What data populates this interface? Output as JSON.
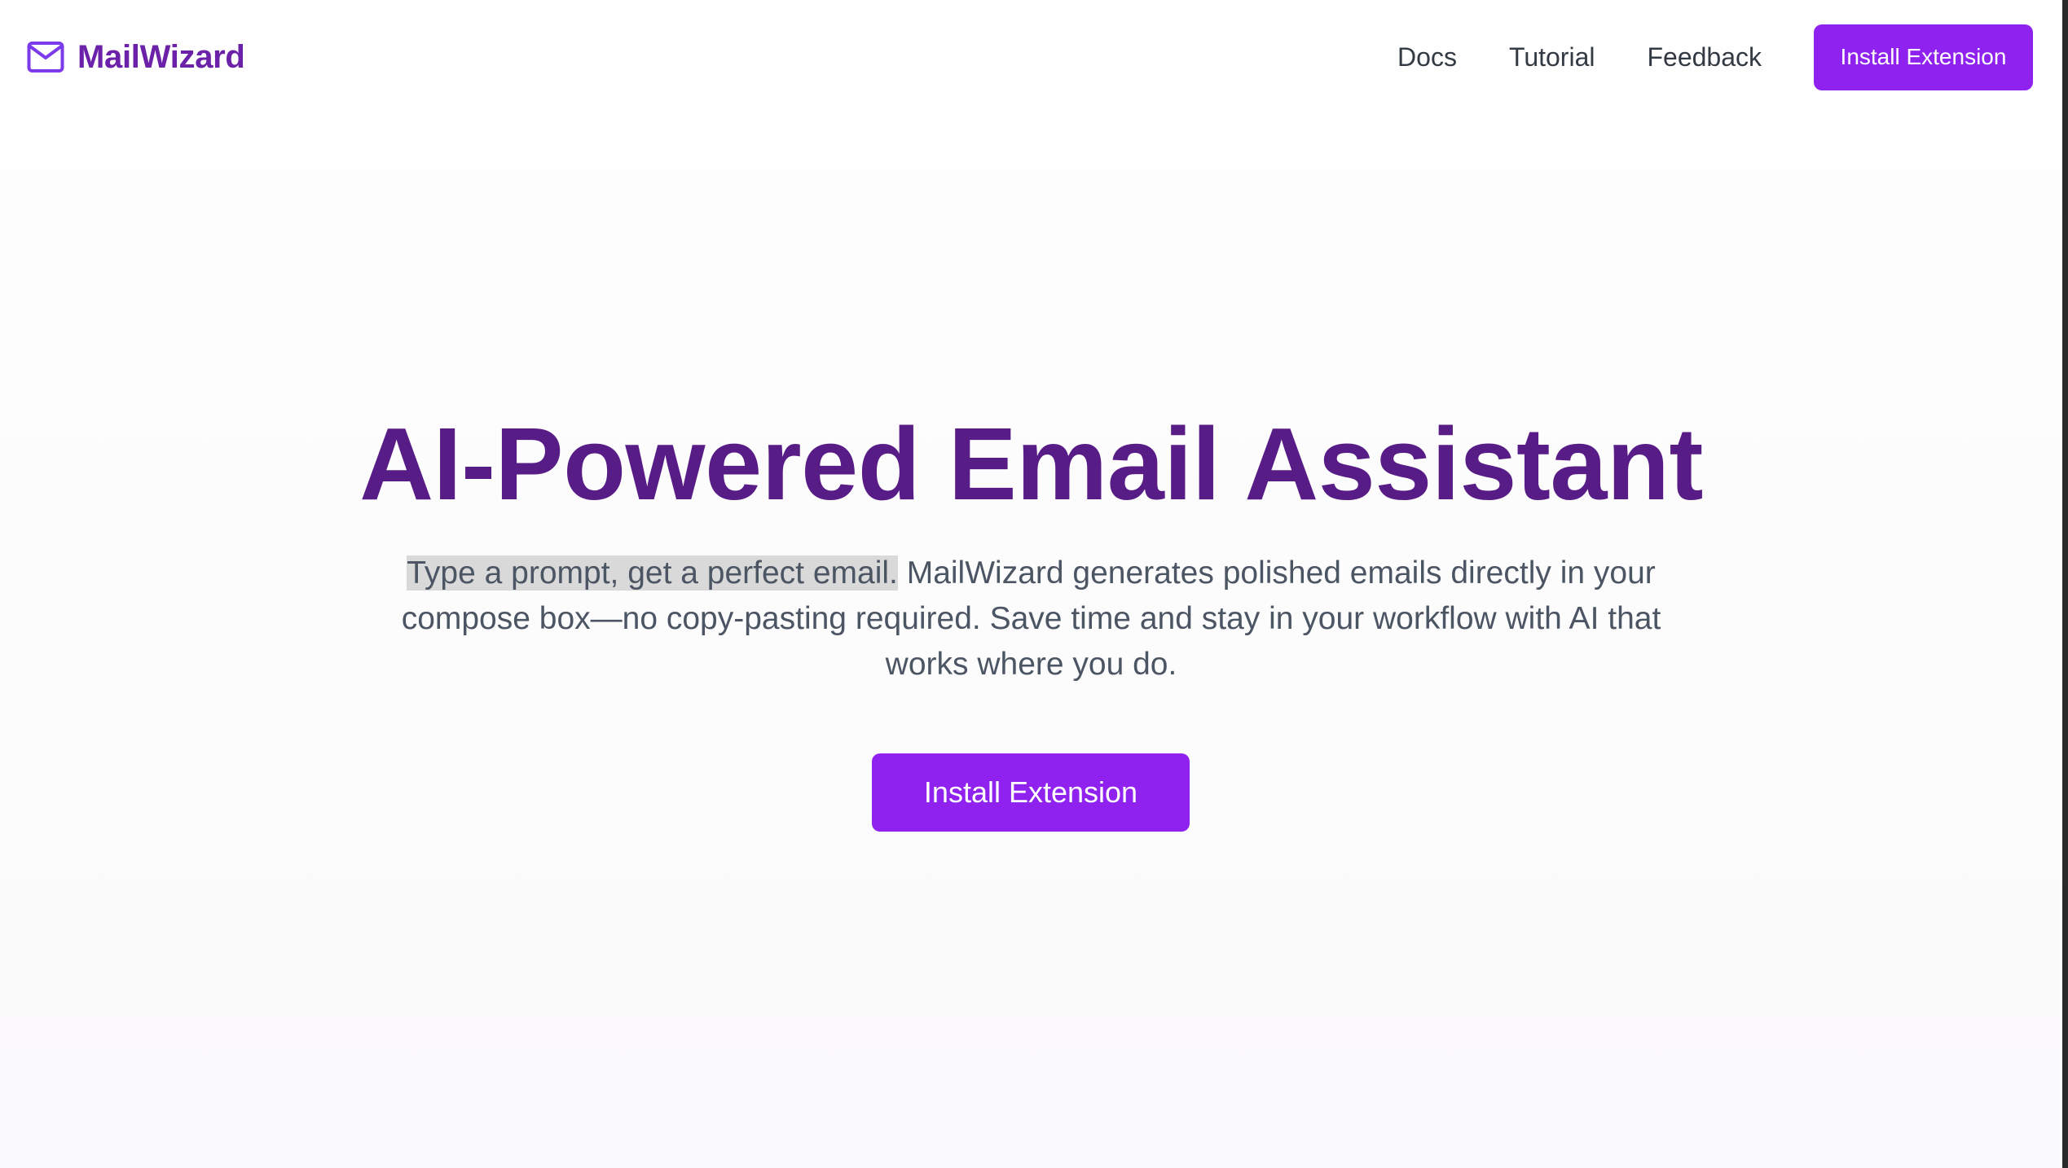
{
  "brand": {
    "name": "MailWizard",
    "icon": "mail-envelope-icon",
    "color": "#6b21a8"
  },
  "nav": {
    "links": [
      "Docs",
      "Tutorial",
      "Feedback"
    ],
    "install_label": "Install Extension"
  },
  "hero": {
    "title": "AI-Powered Email Assistant",
    "desc_highlight": "Type a prompt, get a perfect email.",
    "desc_rest": " MailWizard generates polished emails directly in your compose box—no copy-pasting required. Save time and stay in your workflow with AI that works where you do.",
    "cta_label": "Install Extension"
  },
  "colors": {
    "accent": "#9022ef",
    "title": "#581c87",
    "text": "#4b5563",
    "highlight": "#d9d9d9"
  }
}
